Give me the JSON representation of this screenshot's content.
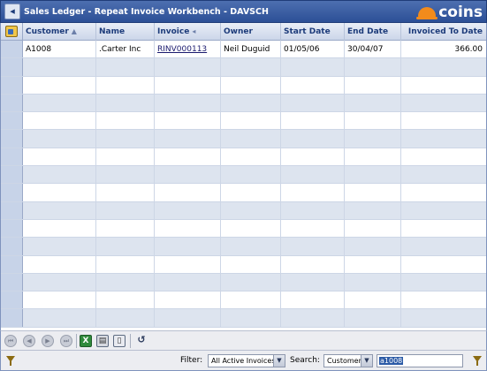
{
  "window": {
    "title": "Sales Ledger - Repeat Invoice Workbench - DAVSCH",
    "logo_text": "coins"
  },
  "grid": {
    "columns": [
      {
        "key": "customer",
        "label": "Customer",
        "sort": "asc"
      },
      {
        "key": "name",
        "label": "Name"
      },
      {
        "key": "invoice",
        "label": "Invoice",
        "sort": "desc"
      },
      {
        "key": "owner",
        "label": "Owner"
      },
      {
        "key": "start_date",
        "label": "Start Date"
      },
      {
        "key": "end_date",
        "label": "End Date"
      },
      {
        "key": "invoiced_to_date",
        "label": "Invoiced To Date"
      }
    ],
    "rows": [
      {
        "customer": "A1008",
        "name": ".Carter Inc",
        "invoice": "RINV000113",
        "owner": "Neil Duguid",
        "start_date": "01/05/06",
        "end_date": "30/04/07",
        "invoiced_to_date": "366.00"
      }
    ]
  },
  "toolbar": {
    "icons": [
      "first-icon",
      "prev-icon",
      "next-icon",
      "last-icon",
      "excel-icon",
      "print-icon",
      "save-icon",
      "undo-icon"
    ]
  },
  "status": {
    "filter_label": "Filter:",
    "filter_value": "All Active Invoices",
    "search_label": "Search:",
    "search_field": "Customer",
    "search_value": "a1008"
  },
  "colors": {
    "titlebar": "#2c4f96",
    "header_text": "#1c3b7a",
    "alt_row": "#dde4ef",
    "logo_accent": "#f28b1c"
  }
}
